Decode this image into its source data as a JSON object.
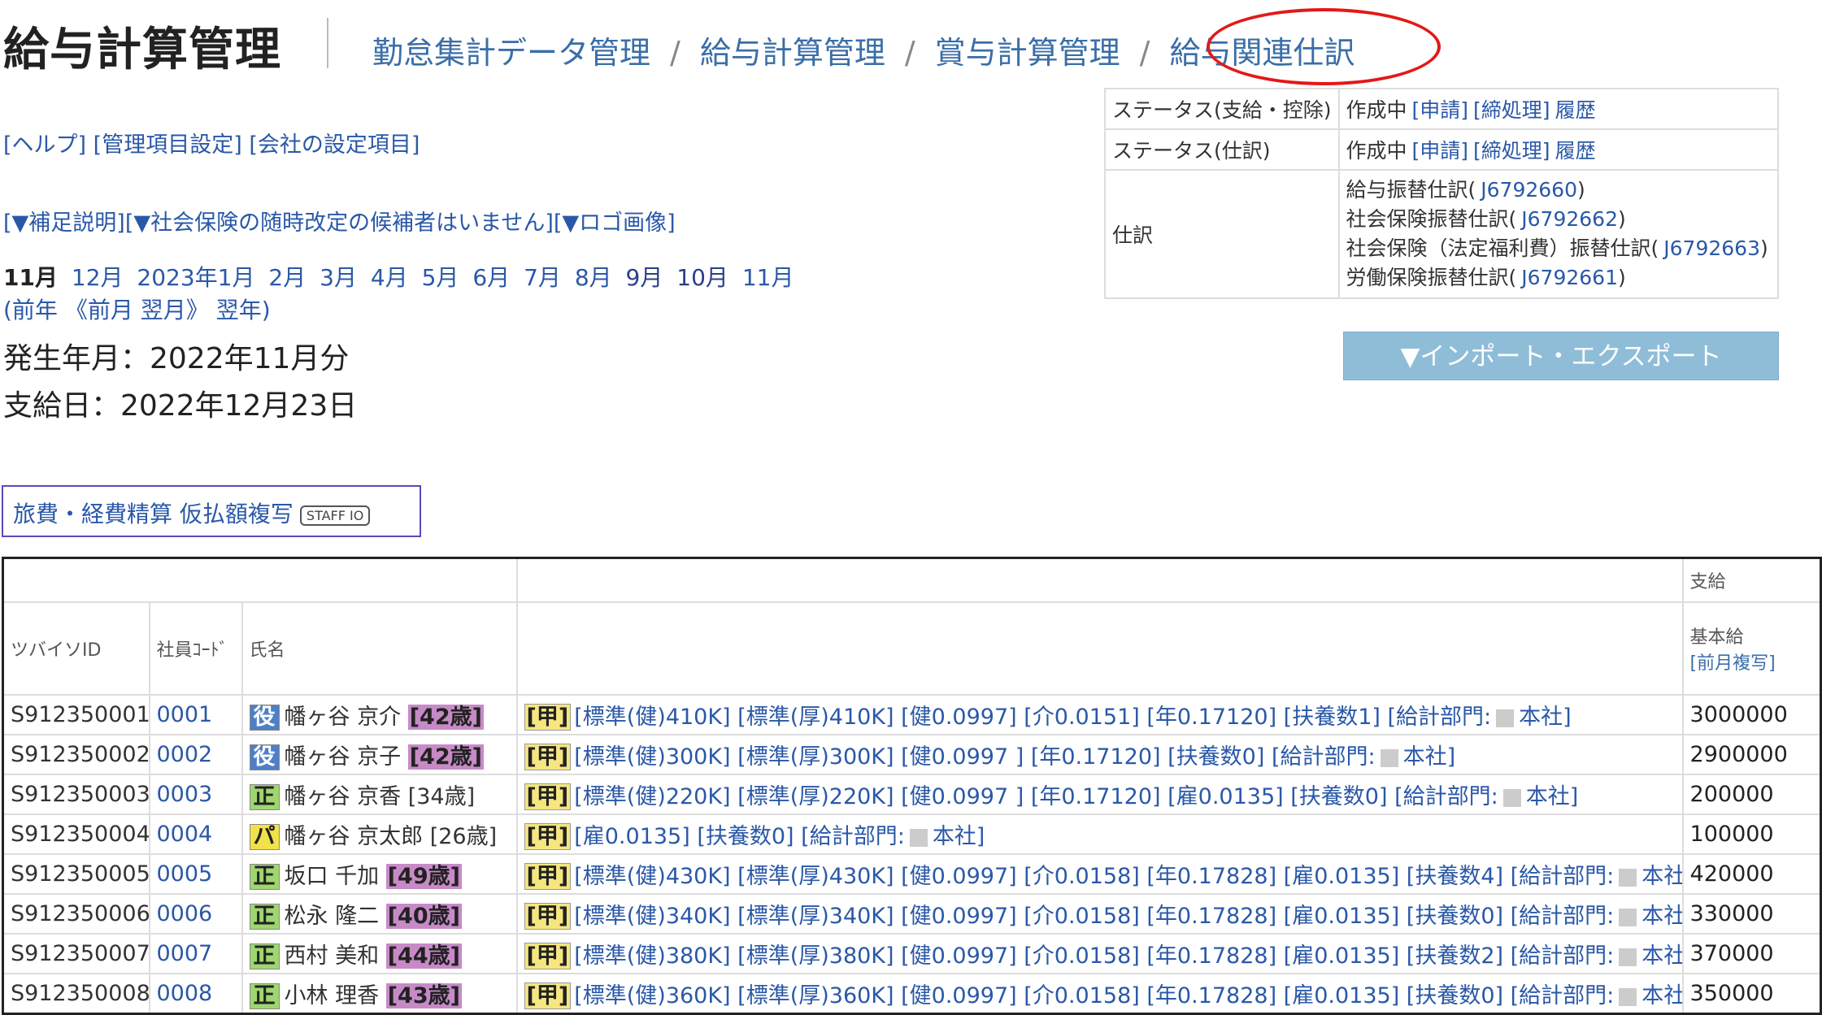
{
  "header": {
    "title": "給与計算管理",
    "nav": [
      "勤怠集計データ管理",
      "給与計算管理",
      "賞与計算管理",
      "給与関連仕訳"
    ],
    "separator": "/"
  },
  "links": {
    "help": "[ヘルプ]",
    "admin_items": "[管理項目設定]",
    "company_settings": "[会社の設定項目]",
    "supplement": "[▼補足説明]",
    "social_insurance": "[▼社会保険の随時改定の候補者はいません]",
    "logo": "[▼ロゴ画像]"
  },
  "months": {
    "current": "11月",
    "list": [
      "12月",
      "2023年1月",
      "2月",
      "3月",
      "4月",
      "5月",
      "6月",
      "7月",
      "8月",
      "9月",
      "10月",
      "11月"
    ],
    "prev_year": "(前年",
    "prev_month": "《前月",
    "next_month": "翌月》",
    "next_year": "翌年)"
  },
  "period": {
    "occurrence": "発生年月：2022年11月分",
    "payday": "支給日：2022年12月23日"
  },
  "travel": {
    "label": "旅費・経費精算 仮払額複写",
    "badge": "STAFF IO"
  },
  "status": {
    "rows": [
      {
        "label": "ステータス(支給・控除)",
        "state": "作成中",
        "apply": "[申請]",
        "close": "[締処理]",
        "history": "履歴"
      },
      {
        "label": "ステータス(仕訳)",
        "state": "作成中",
        "apply": "[申請]",
        "close": "[締処理]",
        "history": "履歴"
      }
    ],
    "journal_label": "仕訳",
    "journals": [
      "給与振替仕訳(J6792660)",
      "社会保険振替仕訳(J6792662)",
      "社会保険（法定福利費）振替仕訳(J6792663)",
      "労働保険振替仕訳(J6792661)"
    ]
  },
  "import_export": "▼インポート・エクスポート",
  "table": {
    "group_pay": "支給",
    "col_id": "ツバイソID",
    "col_code": "社員ｺｰﾄﾞ",
    "col_name": "氏名",
    "col_basic": "基本給",
    "col_copy": "[前月複写]",
    "rows": [
      {
        "id": "S912350001",
        "code": "0001",
        "type": "役",
        "name": "幡ヶ谷 京介",
        "age": "[42歳]",
        "age_hl": true,
        "tax": "[甲]",
        "info": "[標準(健)410K] [標準(厚)410K] [健0.0997] [介0.0151] [年0.17120] [扶養数1] [給計部門:",
        "dept": "本社]",
        "basic": "3000000"
      },
      {
        "id": "S912350002",
        "code": "0002",
        "type": "役",
        "name": "幡ヶ谷 京子",
        "age": "[42歳]",
        "age_hl": true,
        "tax": "[甲]",
        "info": "[標準(健)300K] [標準(厚)300K] [健0.0997 ] [年0.17120] [扶養数0] [給計部門:",
        "dept": "本社]",
        "basic": "2900000"
      },
      {
        "id": "S912350003",
        "code": "0003",
        "type": "正",
        "name": "幡ヶ谷 京香",
        "age": "[34歳]",
        "age_hl": false,
        "tax": "[甲]",
        "info": "[標準(健)220K] [標準(厚)220K] [健0.0997 ] [年0.17120] [雇0.0135] [扶養数0] [給計部門:",
        "dept": "本社]",
        "basic": "200000"
      },
      {
        "id": "S912350004",
        "code": "0004",
        "type": "パ",
        "name": "幡ヶ谷 京太郎",
        "age": "[26歳]",
        "age_hl": false,
        "tax": "[甲]",
        "info": "[雇0.0135] [扶養数0] [給計部門:",
        "dept": "本社]",
        "basic": "100000"
      },
      {
        "id": "S912350005",
        "code": "0005",
        "type": "正",
        "name": "坂口 千加",
        "age": "[49歳]",
        "age_hl": true,
        "tax": "[甲]",
        "info": "[標準(健)430K] [標準(厚)430K] [健0.0997] [介0.0158] [年0.17828] [雇0.0135] [扶養数4] [給計部門:",
        "dept": "本社]",
        "basic": "420000"
      },
      {
        "id": "S912350006",
        "code": "0006",
        "type": "正",
        "name": "松永 隆二",
        "age": "[40歳]",
        "age_hl": true,
        "tax": "[甲]",
        "info": "[標準(健)340K] [標準(厚)340K] [健0.0997] [介0.0158] [年0.17828] [雇0.0135] [扶養数0] [給計部門:",
        "dept": "本社]",
        "basic": "330000"
      },
      {
        "id": "S912350007",
        "code": "0007",
        "type": "正",
        "name": "西村 美和",
        "age": "[44歳]",
        "age_hl": true,
        "tax": "[甲]",
        "info": "[標準(健)380K] [標準(厚)380K] [健0.0997] [介0.0158] [年0.17828] [雇0.0135] [扶養数2] [給計部門:",
        "dept": "本社]",
        "basic": "370000"
      },
      {
        "id": "S912350008",
        "code": "0008",
        "type": "正",
        "name": "小林 理香",
        "age": "[43歳]",
        "age_hl": true,
        "tax": "[甲]",
        "info": "[標準(健)360K] [標準(厚)360K] [健0.0997] [介0.0158] [年0.17828] [雇0.0135] [扶養数0] [給計部門:",
        "dept": "本社]",
        "basic": "350000"
      }
    ]
  },
  "colors": {
    "link": "#2a58a8",
    "highlight_circle": "#e41818",
    "import_button": "#8fbdd8"
  }
}
